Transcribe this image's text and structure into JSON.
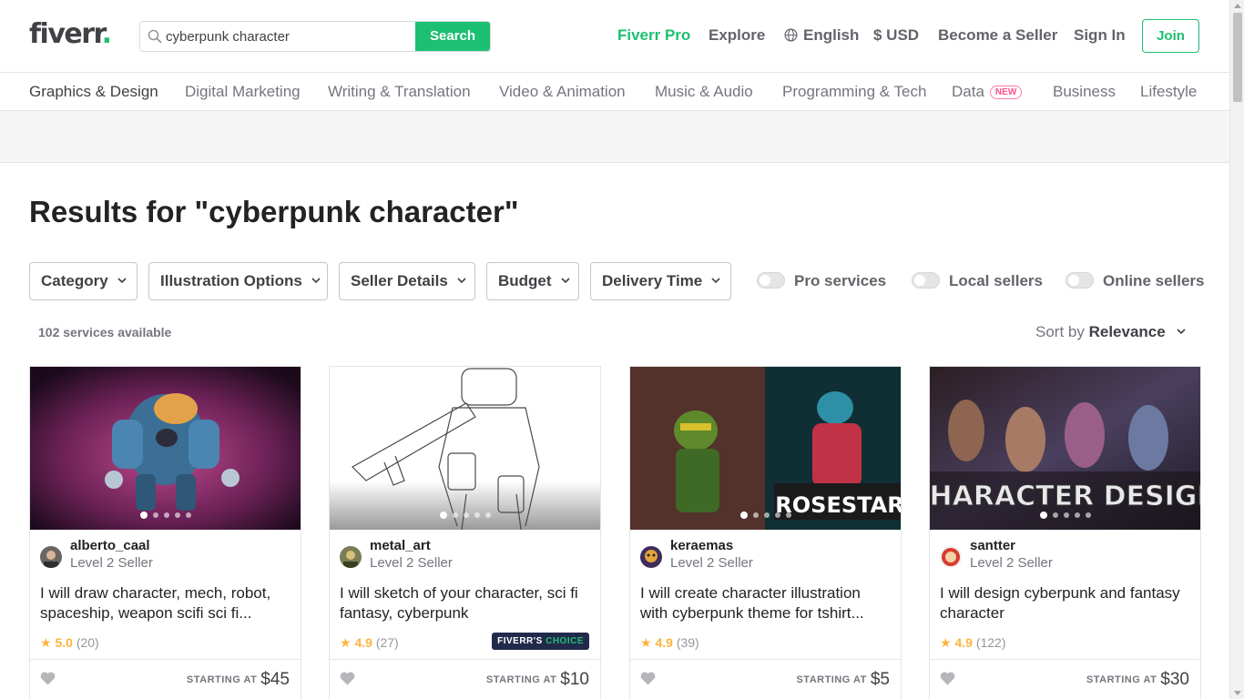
{
  "header": {
    "logo_text": "fiverr",
    "logo_dot": ".",
    "search": {
      "value": "cyberpunk character",
      "button": "Search"
    },
    "nav": {
      "pro": "Fiverr Pro",
      "explore": "Explore",
      "language": "English",
      "currency": "$ USD",
      "become_seller": "Become a Seller",
      "sign_in": "Sign In",
      "join": "Join"
    }
  },
  "categories": [
    "Graphics & Design",
    "Digital Marketing",
    "Writing & Translation",
    "Video & Animation",
    "Music & Audio",
    "Programming & Tech",
    "Data",
    "Business",
    "Lifestyle"
  ],
  "new_badge": "NEW",
  "results": {
    "title": "Results for \"cyberpunk character\"",
    "count": "102 services available",
    "sort_label": "Sort by",
    "sort_value": "Relevance"
  },
  "filters": [
    "Category",
    "Illustration Options",
    "Seller Details",
    "Budget",
    "Delivery Time"
  ],
  "toggles": [
    "Pro services",
    "Local sellers",
    "Online sellers"
  ],
  "gigs": [
    {
      "seller": "alberto_caal",
      "level": "Level 2 Seller",
      "title": "I will draw character, mech, robot, spaceship, weapon scifi sci fi...",
      "rating": "5.0",
      "reviews": "(20)",
      "starting": "STARTING AT",
      "price": "$45"
    },
    {
      "seller": "metal_art",
      "level": "Level 2 Seller",
      "title": "I will sketch of your character, sci fi fantasy, cyberpunk",
      "rating": "4.9",
      "reviews": "(27)",
      "badge_a": "FIVERR'S",
      "badge_b": "CHOICE",
      "starting": "STARTING AT",
      "price": "$10"
    },
    {
      "seller": "keraemas",
      "level": "Level 2 Seller",
      "title": "I will create character illustration with cyberpunk theme for tshirt...",
      "rating": "4.9",
      "reviews": "(39)",
      "image_text": "ROSESTAR",
      "starting": "STARTING AT",
      "price": "$5"
    },
    {
      "seller": "santter",
      "level": "Level 2 Seller",
      "title": "I will design cyberpunk and fantasy character",
      "rating": "4.9",
      "reviews": "(122)",
      "image_text": "CHARACTER DESIGN",
      "starting": "STARTING AT",
      "price": "$30"
    }
  ],
  "colors": {
    "brand_green": "#1dbf73",
    "star": "#ffb33e",
    "choice_bg": "#222a4b",
    "new_badge": "#ff4f8b"
  }
}
